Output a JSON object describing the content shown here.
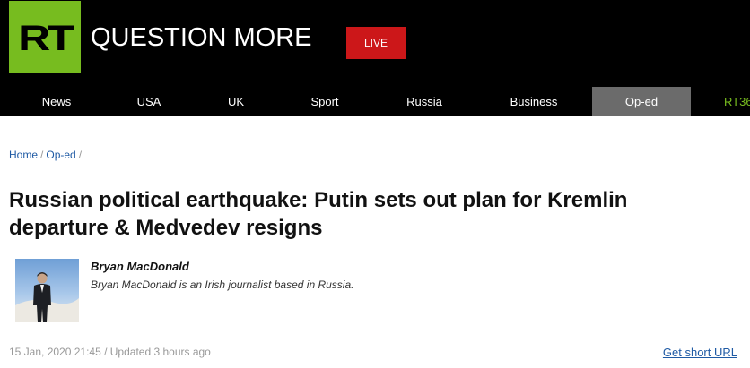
{
  "header": {
    "logo_text": "RT",
    "tagline": "QUESTION MORE",
    "live_label": "LIVE",
    "brand_color": "#77bc1f",
    "live_color": "#cc1719"
  },
  "nav": {
    "items": [
      {
        "label": "News"
      },
      {
        "label": "USA"
      },
      {
        "label": "UK"
      },
      {
        "label": "Sport"
      },
      {
        "label": "Russia"
      },
      {
        "label": "Business"
      },
      {
        "label": "Op-ed"
      },
      {
        "label": "RT36"
      }
    ],
    "active": "Op-ed"
  },
  "breadcrumb": {
    "items": [
      {
        "label": "Home"
      },
      {
        "label": "Op-ed"
      }
    ],
    "separator": "/"
  },
  "article": {
    "title": "Russian political earthquake: Putin sets out plan for Kremlin departure & Medvedev resigns",
    "author": {
      "name": "Bryan MacDonald",
      "bio": "Bryan MacDonald is an Irish journalist based in Russia."
    },
    "date_line": "15 Jan, 2020 21:45 / Updated 3 hours ago",
    "short_url_label": "Get short URL"
  }
}
